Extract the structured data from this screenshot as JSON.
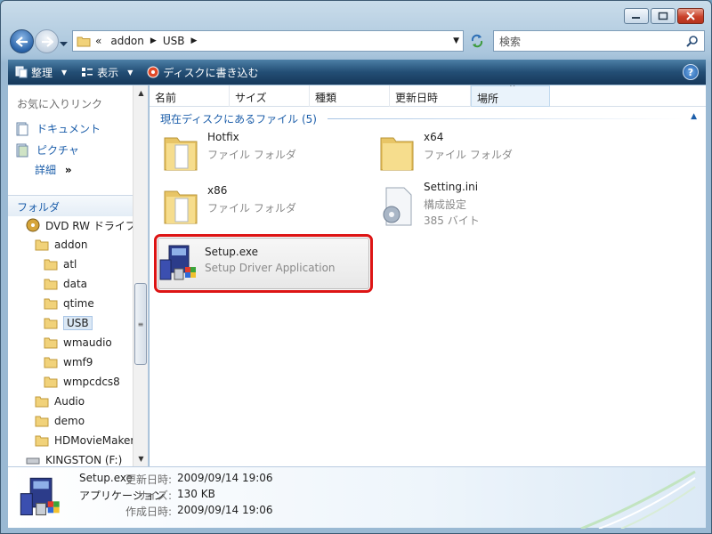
{
  "window": {
    "caption_buttons": [
      "minimize",
      "maximize",
      "close"
    ]
  },
  "address_bar": {
    "prefix": "«",
    "segments": [
      "addon",
      "USB"
    ]
  },
  "search": {
    "placeholder": "検索"
  },
  "toolbar": {
    "organize": "整理",
    "views": "表示",
    "burn": "ディスクに書き込む",
    "help": "?"
  },
  "left_pane": {
    "favorites_title": "お気に入りリンク",
    "favorites": [
      "ドキュメント",
      "ピクチャ"
    ],
    "more": "詳細",
    "more_arrow": "»",
    "folders_title": "フォルダ",
    "tree": [
      {
        "label": "DVD RW ドライブ",
        "type": "dvd"
      },
      {
        "label": "addon",
        "type": "folder"
      },
      {
        "label": "atl",
        "type": "folder"
      },
      {
        "label": "data",
        "type": "folder"
      },
      {
        "label": "qtime",
        "type": "folder"
      },
      {
        "label": "USB",
        "type": "folder",
        "selected": true
      },
      {
        "label": "wmaudio",
        "type": "folder"
      },
      {
        "label": "wmf9",
        "type": "folder"
      },
      {
        "label": "wmpcdcs8",
        "type": "folder"
      },
      {
        "label": "Audio",
        "type": "folder"
      },
      {
        "label": "demo",
        "type": "folder"
      },
      {
        "label": "HDMovieMaker",
        "type": "folder"
      },
      {
        "label": "KINGSTON (F:)",
        "type": "drive"
      }
    ]
  },
  "columns": [
    "名前",
    "サイズ",
    "種類",
    "更新日時",
    "場所"
  ],
  "group": {
    "title": "現在ディスクにあるファイル (5)"
  },
  "files": [
    {
      "name": "Hotfix",
      "desc": "ファイル フォルダ",
      "icon": "folder-icon"
    },
    {
      "name": "x64",
      "desc": "ファイル フォルダ",
      "icon": "folder-icon"
    },
    {
      "name": "x86",
      "desc": "ファイル フォルダ",
      "icon": "folder-icon"
    },
    {
      "name": "Setting.ini",
      "desc": "構成設定",
      "desc2": "385 バイト",
      "icon": "settings-file-icon"
    },
    {
      "name": "Setup.exe",
      "desc": "Setup Driver Application",
      "icon": "setup-exe-icon",
      "selected": true
    }
  ],
  "details": {
    "name": "Setup.exe",
    "type": "アプリケーション",
    "modified_label": "更新日時:",
    "modified": "2009/09/14 19:06",
    "size_label": "サイズ:",
    "size": "130 KB",
    "created_label": "作成日時:",
    "created": "2009/09/14 19:06"
  },
  "colors": {
    "link_blue": "#1c5eaa",
    "toolbar_dark": "#16385a",
    "highlight_red": "#dd1414"
  }
}
